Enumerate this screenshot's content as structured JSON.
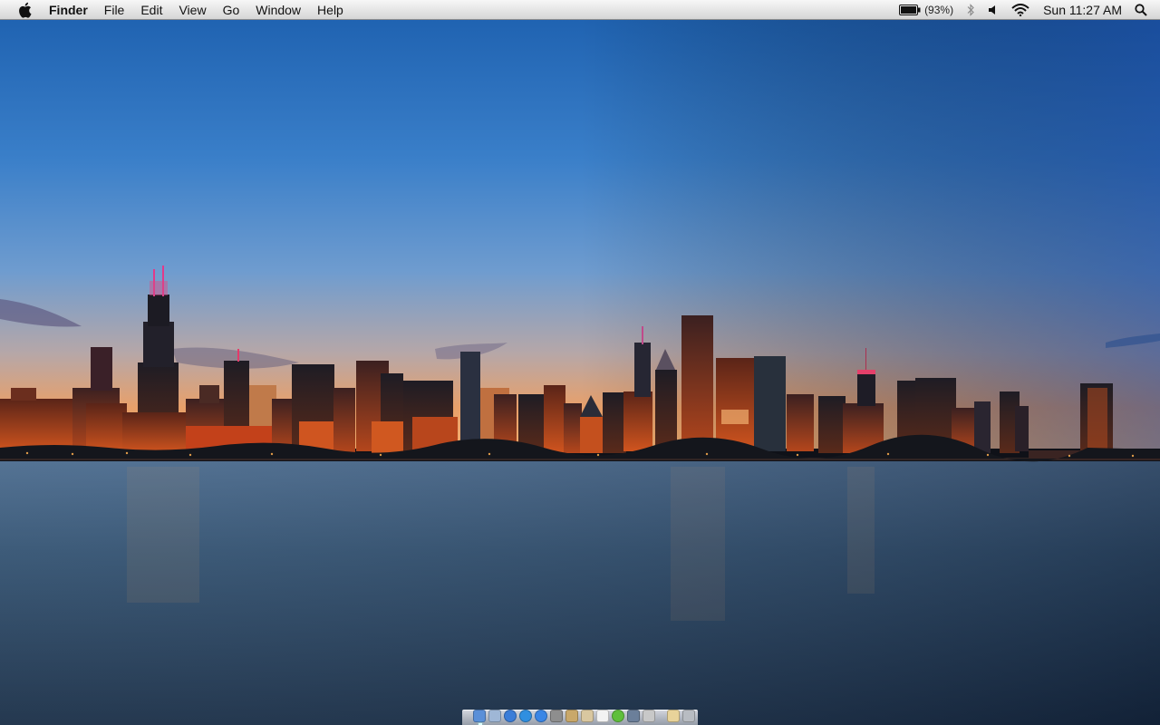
{
  "menubar": {
    "app_name": "Finder",
    "menus": [
      "File",
      "Edit",
      "View",
      "Go",
      "Window",
      "Help"
    ],
    "battery": "(93%)",
    "clock": "Sun 11:27 AM",
    "icons": [
      "apple-logo-icon",
      "battery-icon",
      "bluetooth-icon",
      "volume-icon",
      "wifi-icon",
      "spotlight-search-icon"
    ]
  },
  "dock": {
    "items": [
      {
        "name": "finder",
        "color": "#5a8fd8",
        "shape": "square"
      },
      {
        "name": "mail",
        "color": "#9fb7d6",
        "shape": "square"
      },
      {
        "name": "browser-globe",
        "color": "#3b7dd8",
        "shape": "round"
      },
      {
        "name": "safari",
        "color": "#2f8fe0",
        "shape": "round"
      },
      {
        "name": "app-store",
        "color": "#3a86e6",
        "shape": "round"
      },
      {
        "name": "photo-app",
        "color": "#8e8e8e",
        "shape": "square"
      },
      {
        "name": "contacts",
        "color": "#c9a86a",
        "shape": "square"
      },
      {
        "name": "preview",
        "color": "#d9c7a0",
        "shape": "square"
      },
      {
        "name": "textedit",
        "color": "#f2f2f2",
        "shape": "square"
      },
      {
        "name": "leaf-app",
        "color": "#5fbf3c",
        "shape": "round"
      },
      {
        "name": "xcode",
        "color": "#6b7f9a",
        "shape": "square"
      },
      {
        "name": "utilities",
        "color": "#c8c8c8",
        "shape": "square"
      },
      {
        "name": "documents-stack",
        "color": "#e8d39a",
        "shape": "square"
      },
      {
        "name": "trash",
        "color": "#b8bcc2",
        "shape": "square"
      }
    ]
  }
}
